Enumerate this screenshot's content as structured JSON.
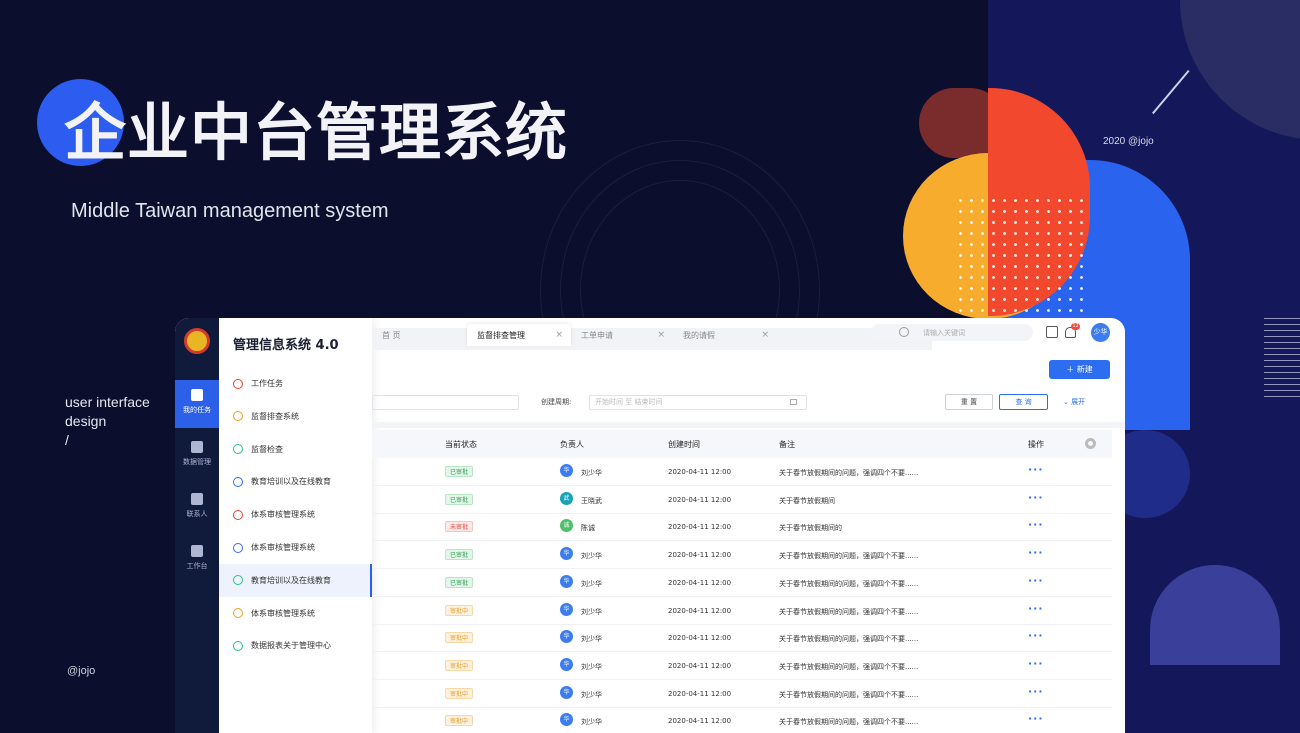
{
  "hero": {
    "title": "企业中台管理系统",
    "subtitle": "Middle Taiwan management system",
    "ui_label_line1": "user interface",
    "ui_label_line2": "design",
    "ui_label_line3": "/",
    "credit_bottom": "@jojo",
    "credit_top": "2020 @jojo"
  },
  "colors": {
    "background": "#0b0e2c",
    "accent_blue": "#2c5cf0",
    "accent_red": "#f2482e",
    "accent_yellow": "#f7ac2d"
  },
  "app": {
    "rail": [
      {
        "label": "我的任务",
        "icon": "task-icon",
        "active": true
      },
      {
        "label": "数据管理",
        "icon": "chart-pie-icon",
        "active": false
      },
      {
        "label": "联系人",
        "icon": "contact-icon",
        "active": false
      },
      {
        "label": "工作台",
        "icon": "workbench-icon",
        "active": false
      }
    ],
    "menu_title": "管理信息系统 4.0",
    "menu": [
      {
        "label": "工作任务",
        "color": "#e2452f"
      },
      {
        "label": "监督排查系统",
        "color": "#f0a020"
      },
      {
        "label": "监督检查",
        "color": "#2fbf8a"
      },
      {
        "label": "教育培训以及在线教育",
        "color": "#2d6ef0"
      },
      {
        "label": "体系审核管理系统",
        "color": "#e2452f"
      },
      {
        "label": "体系审核管理系统",
        "color": "#2d6ef0"
      },
      {
        "label": "教育培训以及在线教育",
        "color": "#2fbf8a"
      },
      {
        "label": "体系审核管理系统",
        "color": "#f0a020"
      },
      {
        "label": "数据报表关于管理中心",
        "color": "#2fbf8a"
      }
    ],
    "tabs": [
      {
        "label": "首 页"
      },
      {
        "label": "监督排查管理"
      },
      {
        "label": "工单申请"
      },
      {
        "label": "我的请假"
      }
    ],
    "search_placeholder": "请输入关键词",
    "notif_count": "12",
    "avatar": "少华",
    "new_button": "新建",
    "filter": {
      "label_period": "创建周期:",
      "date_placeholder": "开始时间 至 结束时间",
      "reset": "重 置",
      "query": "查 询",
      "expand": "展开"
    },
    "table": {
      "headers": [
        "当前状态",
        "负责人",
        "创建时间",
        "备注",
        "操作"
      ],
      "rows": [
        {
          "status": "已审批",
          "kind": "ok",
          "avatar": "华",
          "avcolor": "#3b7cf0",
          "owner": "刘少华",
          "time": "2020-04-11  12:00",
          "note": "关于春节放假期间的问题，强调四个不要......"
        },
        {
          "status": "已审批",
          "kind": "ok",
          "avatar": "武",
          "avcolor": "#17a2b8",
          "owner": "王晓武",
          "time": "2020-04-11  12:00",
          "note": "关于春节放假期间"
        },
        {
          "status": "未审批",
          "kind": "no",
          "avatar": "诚",
          "avcolor": "#4cc06a",
          "owner": "陈诚",
          "time": "2020-04-11  12:00",
          "note": "关于春节放假期间的"
        },
        {
          "status": "已审批",
          "kind": "ok",
          "avatar": "华",
          "avcolor": "#3b7cf0",
          "owner": "刘少华",
          "time": "2020-04-11  12:00",
          "note": "关于春节放假期间的问题，强调四个不要......"
        },
        {
          "status": "已审批",
          "kind": "ok",
          "avatar": "华",
          "avcolor": "#3b7cf0",
          "owner": "刘少华",
          "time": "2020-04-11  12:00",
          "note": "关于春节放假期间的问题，强调四个不要......"
        },
        {
          "status": "审批中",
          "kind": "mid",
          "avatar": "华",
          "avcolor": "#3b7cf0",
          "owner": "刘少华",
          "time": "2020-04-11  12:00",
          "note": "关于春节放假期间的问题，强调四个不要......"
        },
        {
          "status": "审批中",
          "kind": "mid",
          "avatar": "华",
          "avcolor": "#3b7cf0",
          "owner": "刘少华",
          "time": "2020-04-11  12:00",
          "note": "关于春节放假期间的问题，强调四个不要......"
        },
        {
          "status": "审批中",
          "kind": "mid",
          "avatar": "华",
          "avcolor": "#3b7cf0",
          "owner": "刘少华",
          "time": "2020-04-11  12:00",
          "note": "关于春节放假期间的问题，强调四个不要......"
        },
        {
          "status": "审批中",
          "kind": "mid",
          "avatar": "华",
          "avcolor": "#3b7cf0",
          "owner": "刘少华",
          "time": "2020-04-11  12:00",
          "note": "关于春节放假期间的问题，强调四个不要......"
        },
        {
          "status": "审批中",
          "kind": "mid",
          "avatar": "华",
          "avcolor": "#3b7cf0",
          "owner": "刘少华",
          "time": "2020-04-11  12:00",
          "note": "关于春节放假期间的问题，强调四个不要......"
        }
      ]
    }
  }
}
